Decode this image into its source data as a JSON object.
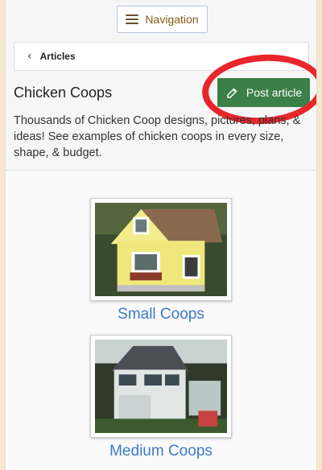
{
  "nav": {
    "label": "Navigation"
  },
  "breadcrumb": {
    "label": "Articles"
  },
  "page": {
    "title": "Chicken Coops",
    "post_button": "Post article",
    "description": "Thousands of Chicken Coop designs, pictures, plans, & ideas! See examples of chicken coops in every size, shape, & budget."
  },
  "coops": [
    {
      "label": "Small Coops"
    },
    {
      "label": "Medium Coops"
    }
  ],
  "colors": {
    "accent_green": "#3b7f49",
    "link_blue": "#3d7bc9",
    "annotation_red": "#e8262c"
  }
}
